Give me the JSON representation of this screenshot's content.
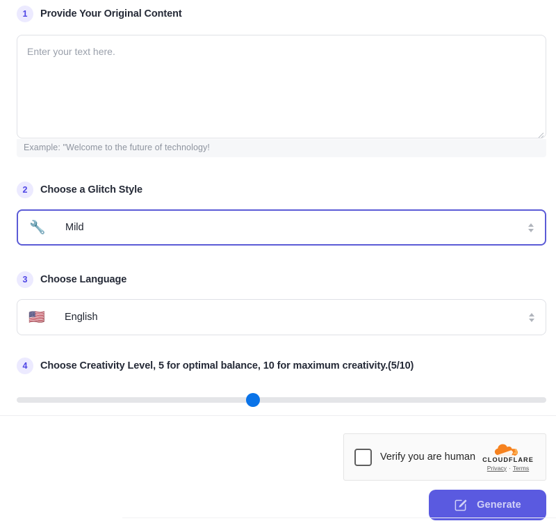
{
  "steps": [
    {
      "number": "1",
      "title": "Provide Your Original Content",
      "placeholder": "Enter your text here.",
      "value": "",
      "example": "Example:  \"Welcome to the future of technology!"
    },
    {
      "number": "2",
      "title": "Choose a Glitch Style",
      "icon": "wrench-emoji",
      "emoji": "🔧",
      "value": "Mild"
    },
    {
      "number": "3",
      "title": "Choose Language",
      "icon": "us-flag-emoji",
      "emoji": "🇺🇸",
      "value": "English"
    },
    {
      "number": "4",
      "title": "Choose Creativity Level, 5 for optimal balance, 10 for maximum creativity.(5/10)",
      "slider": {
        "value": 5,
        "min": 1,
        "max": 10,
        "percent": 44.6
      }
    }
  ],
  "turnstile": {
    "label": "Verify you are human",
    "checked": false,
    "brand": "CLOUDFLARE",
    "privacy_label": "Privacy",
    "separator": "·",
    "terms_label": "Terms"
  },
  "generate": {
    "label": "Generate",
    "icon": "edit-square-icon",
    "disabled": true
  },
  "colors": {
    "accent_indigo": "#5a5ae0",
    "badge_bg": "#eceaff",
    "badge_text": "#4f46e5",
    "slider_thumb": "#0a73e8",
    "slider_track": "#e4e5e8",
    "cloudflare_orange": "#f6821f"
  }
}
